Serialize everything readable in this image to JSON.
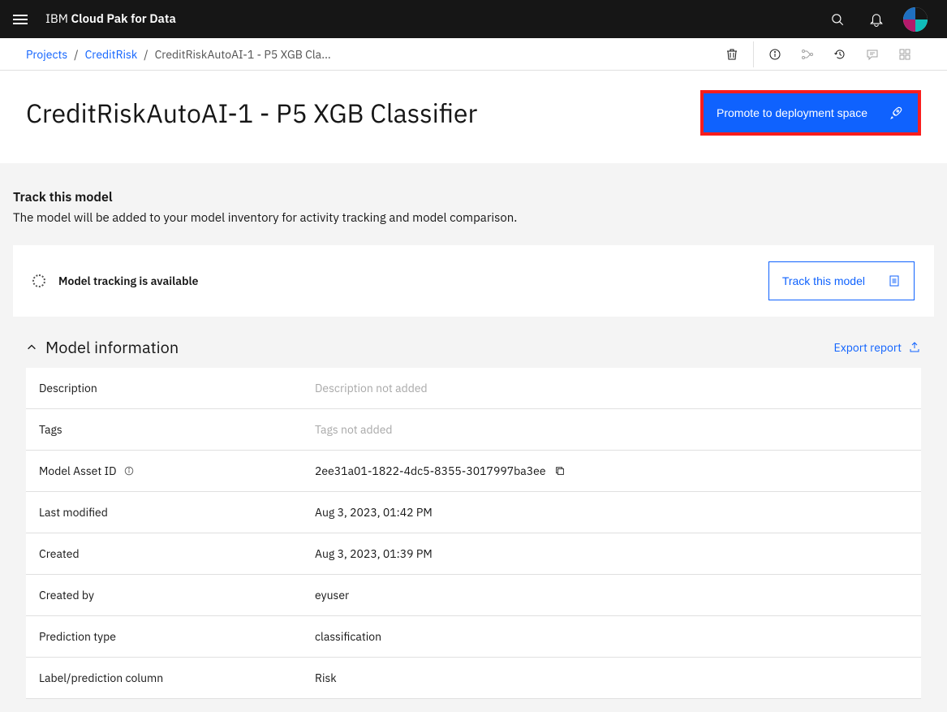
{
  "topbar": {
    "brand_prefix": "IBM",
    "brand_suffix": "Cloud Pak for Data"
  },
  "breadcrumb": {
    "projects": "Projects",
    "project_name": "CreditRisk",
    "current": "CreditRiskAutoAI-1 - P5 XGB Cla..."
  },
  "page": {
    "title": "CreditRiskAutoAI-1 - P5 XGB Classifier",
    "promote_label": "Promote to deployment space"
  },
  "track": {
    "heading": "Track this model",
    "description": "The model will be added to your model inventory for activity tracking and model comparison.",
    "available": "Model tracking is available",
    "button": "Track this model"
  },
  "model_info": {
    "section_title": "Model information",
    "export_label": "Export report",
    "rows": {
      "description": {
        "label": "Description",
        "value": "Description not added",
        "placeholder": true
      },
      "tags": {
        "label": "Tags",
        "value": "Tags not added",
        "placeholder": true
      },
      "asset_id": {
        "label": "Model Asset ID",
        "value": "2ee31a01-1822-4dc5-8355-3017997ba3ee"
      },
      "last_modified": {
        "label": "Last modified",
        "value": "Aug 3, 2023, 01:42 PM"
      },
      "created": {
        "label": "Created",
        "value": "Aug 3, 2023, 01:39 PM"
      },
      "created_by": {
        "label": "Created by",
        "value": "eyuser"
      },
      "prediction_type": {
        "label": "Prediction type",
        "value": "classification"
      },
      "label_column": {
        "label": "Label/prediction column",
        "value": "Risk"
      }
    }
  }
}
